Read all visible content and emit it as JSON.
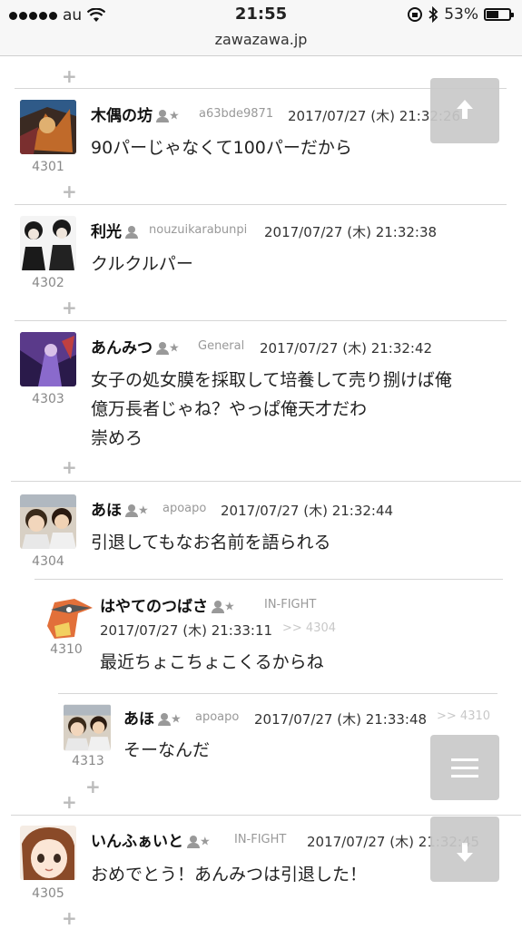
{
  "status": {
    "carrier": "au",
    "time": "21:55",
    "battery": "53%",
    "battery_level": 0.53
  },
  "url": "zawazawa.jp",
  "posts": [
    {
      "num": "4301",
      "name": "木偶の坊",
      "uid": "a63bde9871",
      "date": "2017/07/27 (木) 21:32:26",
      "lines": [
        "90パーじゃなくて100パーだから"
      ]
    },
    {
      "num": "4302",
      "name": "利光",
      "uid": "nouzuikarabunpi",
      "date": "2017/07/27 (木) 21:32:38",
      "lines": [
        "クルクルパー"
      ]
    },
    {
      "num": "4303",
      "name": "あんみつ",
      "uid": "General",
      "date": "2017/07/27 (木) 21:32:42",
      "lines": [
        "女子の処女膜を採取して培養して売り捌けば俺",
        "億万長者じゃね？やっぱ俺天才だわ",
        "崇めろ"
      ]
    },
    {
      "num": "4304",
      "name": "あほ",
      "uid": "apoapo",
      "date": "2017/07/27 (木) 21:32:44",
      "lines": [
        "引退してもなお名前を語られる"
      ]
    },
    {
      "num": "4310",
      "name": "はやてのつばさ",
      "uid": "IN-FIGHT",
      "date": "2017/07/27 (木) 21:33:11",
      "reply": ">> 4304",
      "lines": [
        "最近ちょこちょこくるからね"
      ]
    },
    {
      "num": "4313",
      "name": "あほ",
      "uid": "apoapo",
      "date": "2017/07/27 (木) 21:33:48",
      "reply": ">> 4310",
      "lines": [
        "そーなんだ"
      ]
    },
    {
      "num": "4305",
      "name": "いんふぁいと",
      "uid": "IN-FIGHT",
      "date": "2017/07/27 (木) 21:32:45",
      "lines": [
        "おめでとう！あんみつは引退した！"
      ]
    }
  ],
  "plus_label": "+",
  "star": "★",
  "icons": {
    "scroll_top": "arrow-up-icon",
    "menu": "menu-icon",
    "scroll_bottom": "arrow-down-icon"
  }
}
